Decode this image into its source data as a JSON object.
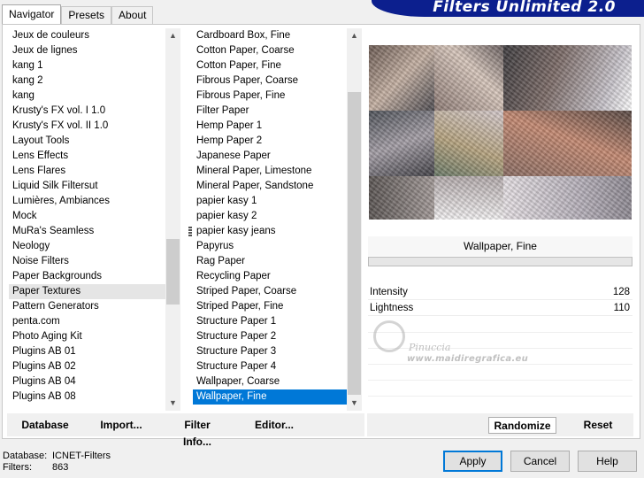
{
  "tabs": [
    {
      "label": "Navigator",
      "active": true
    },
    {
      "label": "Presets",
      "active": false
    },
    {
      "label": "About",
      "active": false
    }
  ],
  "banner_title": "Filters Unlimited 2.0",
  "categories": [
    "Jeux de couleurs",
    "Jeux de lignes",
    "kang 1",
    "kang 2",
    "kang",
    "Krusty's FX vol. I 1.0",
    "Krusty's FX vol. II 1.0",
    "Layout Tools",
    "Lens Effects",
    "Lens Flares",
    "Liquid Silk Filtersut",
    "Lumières, Ambiances",
    "Mock",
    "MuRa's Seamless",
    "Neology",
    "Noise Filters",
    "Paper Backgrounds",
    "Paper Textures",
    "Pattern Generators",
    "penta.com",
    "Photo Aging Kit",
    "Plugins AB 01",
    "Plugins AB 02",
    "Plugins AB 04",
    "Plugins AB 08"
  ],
  "selected_category": "Paper Textures",
  "filters": [
    "Cardboard Box, Fine",
    "Cotton Paper, Coarse",
    "Cotton Paper, Fine",
    "Fibrous Paper, Coarse",
    "Fibrous Paper, Fine",
    "Filter Paper",
    "Hemp Paper 1",
    "Hemp Paper 2",
    "Japanese Paper",
    "Mineral Paper, Limestone",
    "Mineral Paper, Sandstone",
    "papier kasy 1",
    "papier kasy 2",
    "papier kasy jeans",
    "Papyrus",
    "Rag Paper",
    "Recycling Paper",
    "Striped Paper, Coarse",
    "Striped Paper, Fine",
    "Structure Paper 1",
    "Structure Paper 2",
    "Structure Paper 3",
    "Structure Paper 4",
    "Wallpaper, Coarse",
    "Wallpaper, Fine"
  ],
  "selected_filter": "Wallpaper, Fine",
  "filter_title": "Wallpaper, Fine",
  "params": [
    {
      "label": "Intensity",
      "value": "128"
    },
    {
      "label": "Lightness",
      "value": "110"
    }
  ],
  "watermark": {
    "line1": "Pinuccia",
    "line2": "www.maidiregrafica.eu"
  },
  "left_buttons": {
    "database": "Database",
    "import": "Import...",
    "filter_info": "Filter Info...",
    "editor": "Editor..."
  },
  "right_buttons": {
    "randomize": "Randomize",
    "reset": "Reset"
  },
  "db_info": {
    "database_label": "Database:",
    "database_value": "ICNET-Filters",
    "filters_label": "Filters:",
    "filters_value": "863"
  },
  "dialog_buttons": {
    "apply": "Apply",
    "cancel": "Cancel",
    "help": "Help"
  }
}
